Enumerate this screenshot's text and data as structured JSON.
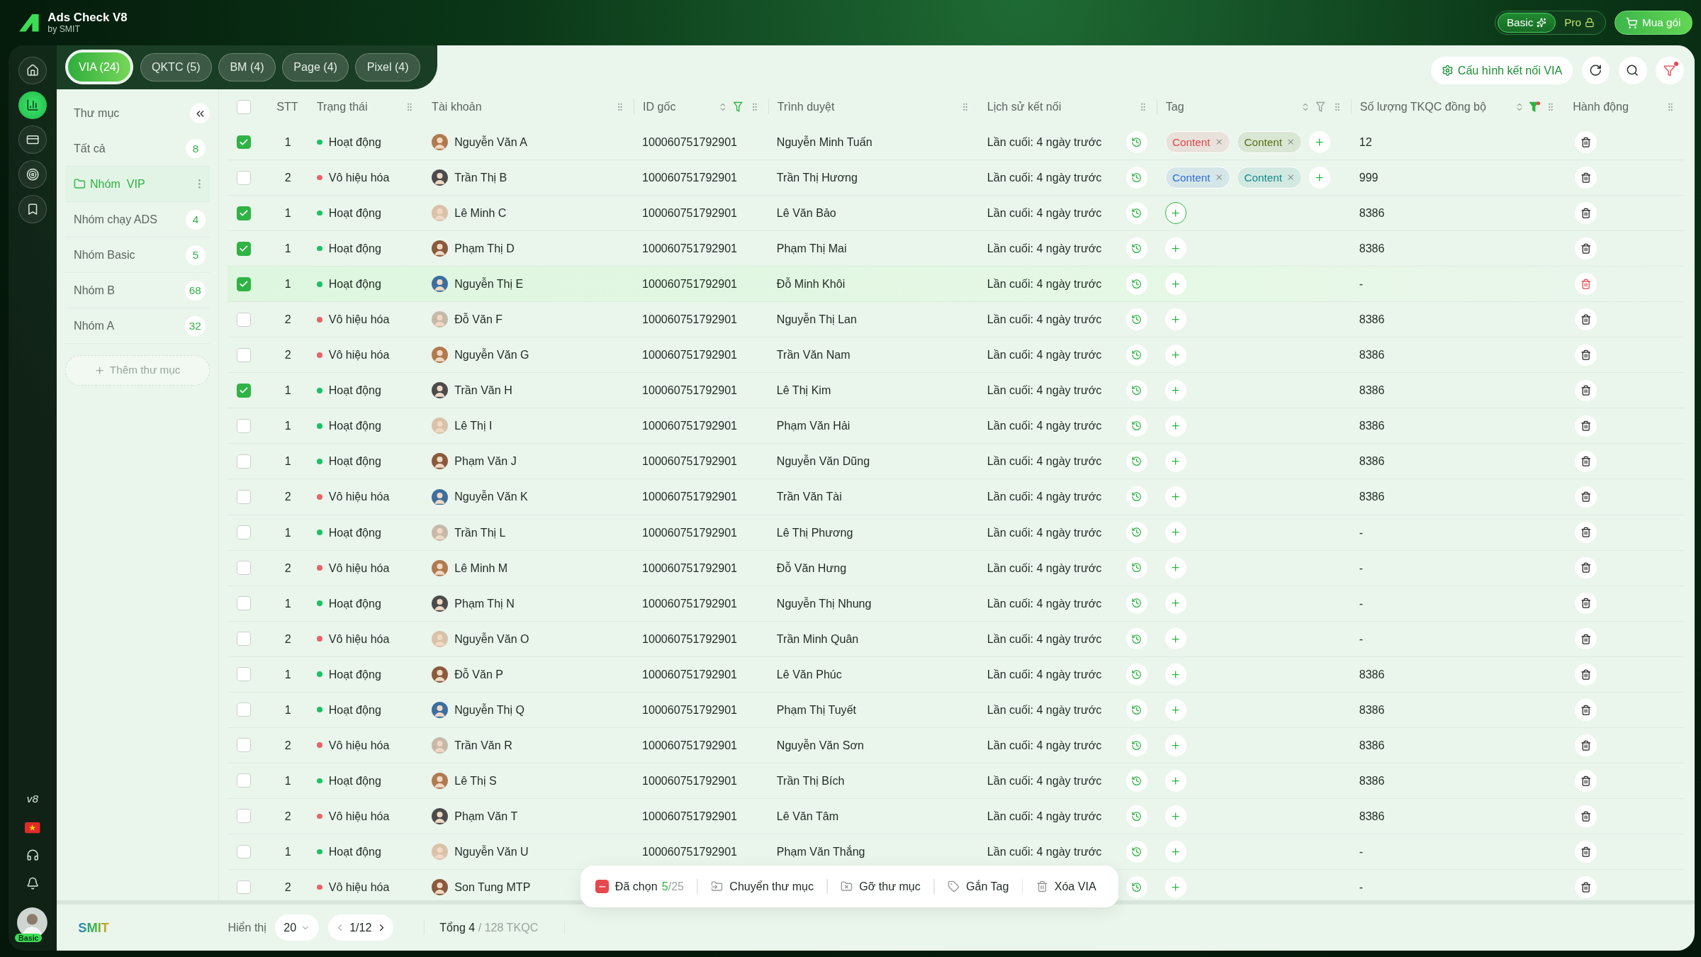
{
  "app": {
    "title": "Ads Check V8",
    "subtitle": "by SMIT"
  },
  "plans": [
    {
      "label": "Basic",
      "selected": true,
      "locked": false
    },
    {
      "label": "Pro",
      "selected": false,
      "locked": true
    }
  ],
  "buy_button": "Mua gói",
  "nav": [
    {
      "kind": "home",
      "selected": false
    },
    {
      "kind": "chart",
      "selected": true
    },
    {
      "kind": "card",
      "selected": false
    },
    {
      "kind": "target",
      "selected": false
    },
    {
      "kind": "bookmark",
      "selected": false
    }
  ],
  "nav_bottom": {
    "version": "v8",
    "badge": "Basic"
  },
  "tabs": [
    {
      "label": "VIA (24)",
      "selected": true
    },
    {
      "label": "QKTC (5)",
      "selected": false
    },
    {
      "label": "BM (4)",
      "selected": false
    },
    {
      "label": "Page (4)",
      "selected": false
    },
    {
      "label": "Pixel (4)",
      "selected": false
    }
  ],
  "toolbar": {
    "config_button": "Cấu hình kết nối VIA",
    "filter_active": true
  },
  "sidebar": {
    "title": "Thư mục",
    "add_button": "Thêm thư mục",
    "folders": [
      {
        "name": "Tất cả",
        "count": "8",
        "selected": false
      },
      {
        "name": "Nhóm  VIP",
        "selected": true
      },
      {
        "name": "Nhóm chạy ADS",
        "count": "4",
        "selected": false
      },
      {
        "name": "Nhóm Basic",
        "count": "5",
        "selected": false
      },
      {
        "name": "Nhóm B",
        "count": "68",
        "selected": false
      },
      {
        "name": "Nhóm A",
        "count": "32",
        "selected": false
      }
    ]
  },
  "table": {
    "header_checked": false,
    "columns": [
      {
        "label": "STT"
      },
      {
        "label": "Trạng thái",
        "grip": true,
        "sortable": false,
        "filterable": false
      },
      {
        "label": "Tài khoản",
        "grip": true,
        "sortable": false,
        "filterable": false
      },
      {
        "label": "ID gốc",
        "grip": true,
        "sortable": true,
        "filterable": true,
        "filter_on": true,
        "filter_dot": false
      },
      {
        "label": "Trình duyệt",
        "grip": true,
        "sortable": false,
        "filterable": false
      },
      {
        "label": "Lịch sử kết nối",
        "grip": true,
        "sortable": false,
        "filterable": false
      },
      {
        "label": "Tag",
        "grip": true,
        "sortable": true,
        "filterable": true,
        "filter_on": false,
        "filter_dot": false
      },
      {
        "label": "Số lượng TKQC đồng bộ",
        "grip": true,
        "sortable": true,
        "filterable": true,
        "filter_on": true,
        "filter_dot": true
      },
      {
        "label": "Hành động",
        "grip": true,
        "sortable": false,
        "filterable": false
      }
    ],
    "rows": [
      {
        "checked": true,
        "stt": "1",
        "active": true,
        "status": "Hoạt động",
        "account": "Nguyễn Văn A",
        "id": "100060751792901",
        "browser": "Nguyễn Minh Tuấn",
        "history": "Lần cuối: 4 ngày trước",
        "tags": [
          {
            "label": "Content",
            "color": "#e0454f"
          },
          {
            "label": "Content",
            "color": "#55700f"
          }
        ],
        "add_focused": false,
        "count": "12",
        "hovered": false
      },
      {
        "checked": false,
        "stt": "2",
        "active": false,
        "status": "Vô hiệu hóa",
        "account": "Trần Thị B",
        "id": "100060751792901",
        "browser": "Trần Thị Hương",
        "history": "Lần cuối: 4 ngày trước",
        "tags": [
          {
            "label": "Content",
            "color": "#2f6fd6"
          },
          {
            "label": "Content",
            "color": "#138a8a"
          }
        ],
        "add_focused": false,
        "count": "999",
        "hovered": false
      },
      {
        "checked": true,
        "stt": "1",
        "active": true,
        "status": "Hoạt động",
        "account": "Lê Minh C",
        "id": "100060751792901",
        "browser": "Lê Văn Bảo",
        "history": "Lần cuối: 4 ngày trước",
        "add_focused": true,
        "count": "8386",
        "hovered": false
      },
      {
        "checked": true,
        "stt": "1",
        "active": true,
        "status": "Hoạt động",
        "account": "Phạm Thị D",
        "id": "100060751792901",
        "browser": "Phạm Thị Mai",
        "history": "Lần cuối: 4 ngày trước",
        "add_focused": false,
        "count": "8386",
        "hovered": false
      },
      {
        "checked": true,
        "stt": "1",
        "active": true,
        "status": "Hoạt động",
        "account": "Nguyễn Thị E",
        "id": "100060751792901",
        "browser": "Đỗ Minh Khôi",
        "history": "Lần cuối: 4 ngày trước",
        "add_focused": false,
        "count": "-",
        "hovered": true
      },
      {
        "checked": false,
        "stt": "2",
        "active": false,
        "status": "Vô hiệu hóa",
        "account": "Đỗ Văn F",
        "id": "100060751792901",
        "browser": "Nguyễn Thị Lan",
        "history": "Lần cuối: 4 ngày trước",
        "add_focused": false,
        "count": "8386",
        "hovered": false
      },
      {
        "checked": false,
        "stt": "2",
        "active": false,
        "status": "Vô hiệu hóa",
        "account": "Nguyễn Văn G",
        "id": "100060751792901",
        "browser": "Trần Văn Nam",
        "history": "Lần cuối: 4 ngày trước",
        "add_focused": false,
        "count": "8386",
        "hovered": false
      },
      {
        "checked": true,
        "stt": "1",
        "active": true,
        "status": "Hoạt động",
        "account": "Trần Văn H",
        "id": "100060751792901",
        "browser": "Lê Thị Kim",
        "history": "Lần cuối: 4 ngày trước",
        "add_focused": false,
        "count": "8386",
        "hovered": false
      },
      {
        "checked": false,
        "stt": "1",
        "active": true,
        "status": "Hoạt động",
        "account": "Lê Thị I",
        "id": "100060751792901",
        "browser": "Phạm Văn Hải",
        "history": "Lần cuối: 4 ngày trước",
        "add_focused": false,
        "count": "8386",
        "hovered": false
      },
      {
        "checked": false,
        "stt": "1",
        "active": true,
        "status": "Hoạt động",
        "account": "Phạm Văn J",
        "id": "100060751792901",
        "browser": "Nguyễn Văn Dũng",
        "history": "Lần cuối: 4 ngày trước",
        "add_focused": false,
        "count": "8386",
        "hovered": false
      },
      {
        "checked": false,
        "stt": "2",
        "active": false,
        "status": "Vô hiệu hóa",
        "account": "Nguyễn Văn K",
        "id": "100060751792901",
        "browser": "Trần Văn Tài",
        "history": "Lần cuối: 4 ngày trước",
        "add_focused": false,
        "count": "8386",
        "hovered": false
      },
      {
        "checked": false,
        "stt": "1",
        "active": true,
        "status": "Hoạt động",
        "account": "Trần Thị L",
        "id": "100060751792901",
        "browser": "Lê Thị Phương",
        "history": "Lần cuối: 4 ngày trước",
        "add_focused": false,
        "count": "-",
        "hovered": false
      },
      {
        "checked": false,
        "stt": "2",
        "active": false,
        "status": "Vô hiệu hóa",
        "account": "Lê Minh M",
        "id": "100060751792901",
        "browser": "Đỗ Văn Hưng",
        "history": "Lần cuối: 4 ngày trước",
        "add_focused": false,
        "count": "-",
        "hovered": false
      },
      {
        "checked": false,
        "stt": "1",
        "active": true,
        "status": "Hoạt động",
        "account": "Phạm Thị N",
        "id": "100060751792901",
        "browser": "Nguyễn Thị Nhung",
        "history": "Lần cuối: 4 ngày trước",
        "add_focused": false,
        "count": "-",
        "hovered": false
      },
      {
        "checked": false,
        "stt": "2",
        "active": false,
        "status": "Vô hiệu hóa",
        "account": "Nguyễn Văn O",
        "id": "100060751792901",
        "browser": "Trần Minh Quân",
        "history": "Lần cuối: 4 ngày trước",
        "add_focused": false,
        "count": "-",
        "hovered": false
      },
      {
        "checked": false,
        "stt": "1",
        "active": true,
        "status": "Hoạt động",
        "account": "Đỗ Văn P",
        "id": "100060751792901",
        "browser": "Lê Văn Phúc",
        "history": "Lần cuối: 4 ngày trước",
        "add_focused": false,
        "count": "8386",
        "hovered": false
      },
      {
        "checked": false,
        "stt": "1",
        "active": true,
        "status": "Hoạt động",
        "account": "Nguyễn Thị Q",
        "id": "100060751792901",
        "browser": "Phạm Thị Tuyết",
        "history": "Lần cuối: 4 ngày trước",
        "add_focused": false,
        "count": "8386",
        "hovered": false
      },
      {
        "checked": false,
        "stt": "2",
        "active": false,
        "status": "Vô hiệu hóa",
        "account": "Trần Văn R",
        "id": "100060751792901",
        "browser": "Nguyễn Văn Sơn",
        "history": "Lần cuối: 4 ngày trước",
        "add_focused": false,
        "count": "8386",
        "hovered": false
      },
      {
        "checked": false,
        "stt": "1",
        "active": true,
        "status": "Hoạt động",
        "account": "Lê Thị S",
        "id": "100060751792901",
        "browser": "Trần Thị Bích",
        "history": "Lần cuối: 4 ngày trước",
        "add_focused": false,
        "count": "8386",
        "hovered": false
      },
      {
        "checked": false,
        "stt": "2",
        "active": false,
        "status": "Vô hiệu hóa",
        "account": "Phạm Văn T",
        "id": "100060751792901",
        "browser": "Lê Văn Tâm",
        "history": "Lần cuối: 4 ngày trước",
        "add_focused": false,
        "count": "8386",
        "hovered": false
      },
      {
        "checked": false,
        "stt": "1",
        "active": true,
        "status": "Hoạt động",
        "account": "Nguyễn Văn U",
        "id": "100060751792901",
        "browser": "Phạm Văn Thắng",
        "history": "Lần cuối: 4 ngày trước",
        "add_focused": false,
        "count": "-",
        "hovered": false
      },
      {
        "checked": false,
        "stt": "2",
        "active": false,
        "status": "Vô hiệu hóa",
        "account": "Son Tung MTP",
        "add_focused": false,
        "count": "-",
        "hovered": false
      }
    ]
  },
  "selection_bar": {
    "label": "Đã chọn",
    "count": "5",
    "total": "/25",
    "actions": [
      {
        "kind": "move",
        "label": "Chuyển thư mục"
      },
      {
        "kind": "remove",
        "label": "Gỡ thư mục"
      },
      {
        "kind": "tag",
        "label": "Gắn Tag"
      },
      {
        "kind": "delete",
        "label": "Xóa VIA"
      }
    ]
  },
  "footer": {
    "logo": "SMIT",
    "show_label": "Hiển thị",
    "page_size": "20",
    "page": "1/12",
    "total": "Tổng 4",
    "total_rest": "/ 128 TKQC"
  }
}
